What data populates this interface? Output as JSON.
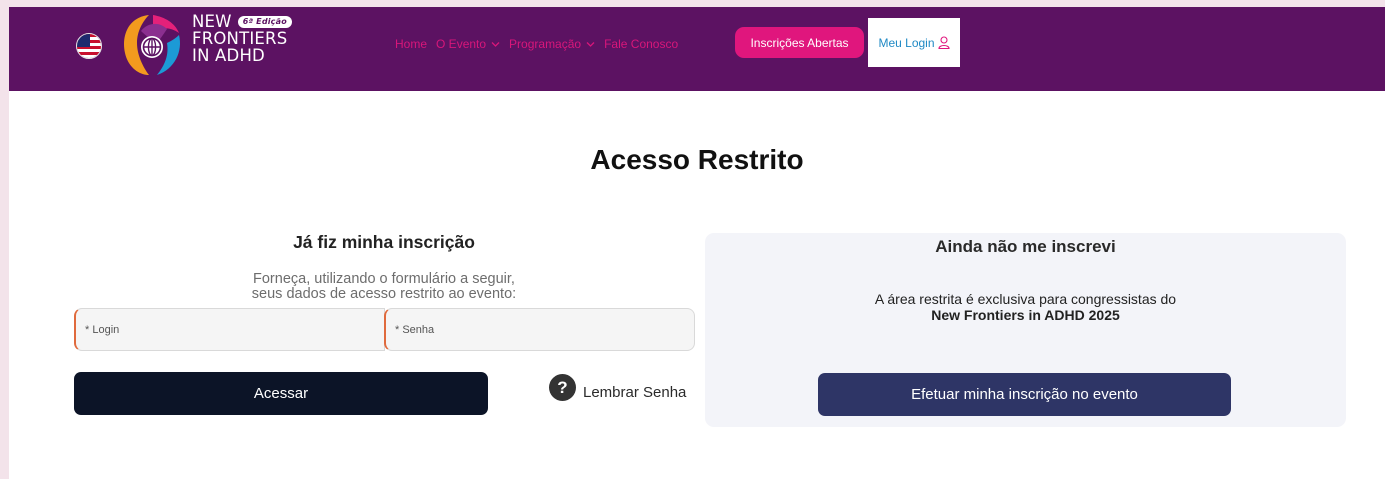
{
  "header": {
    "language_flag": "us-flag-icon",
    "logo": {
      "line1": "NEW",
      "edition_badge": "6ª Edição",
      "line2": "FRONTIERS",
      "line3": "IN ADHD"
    },
    "menu": [
      {
        "label": "Home",
        "dropdown": false
      },
      {
        "label": "O Evento",
        "dropdown": true
      },
      {
        "label": "Programação",
        "dropdown": true
      },
      {
        "label": "Fale Conosco",
        "dropdown": false
      }
    ],
    "registration_button": "Inscrições Abertas",
    "login_button": "Meu Login",
    "colors": {
      "bar": "#5c1262",
      "accent": "#e0167d",
      "link": "#1f89c4"
    }
  },
  "main": {
    "title": "Acesso Restrito",
    "login_section": {
      "title": "Já fiz minha inscrição",
      "description_line1": "Forneça, utilizando o formulário a seguir,",
      "description_line2": "seus dados de acesso restrito ao evento:",
      "login_placeholder": "* Login",
      "password_placeholder": "* Senha",
      "submit_label": "Acessar",
      "remind_label": "Lembrar Senha"
    },
    "register_section": {
      "title": "Ainda não me inscrevi",
      "description_line1": "A área restrita é exclusiva para congressistas do",
      "description_line2": "New Frontiers in ADHD 2025",
      "button_label": "Efetuar minha inscrição no evento"
    }
  }
}
